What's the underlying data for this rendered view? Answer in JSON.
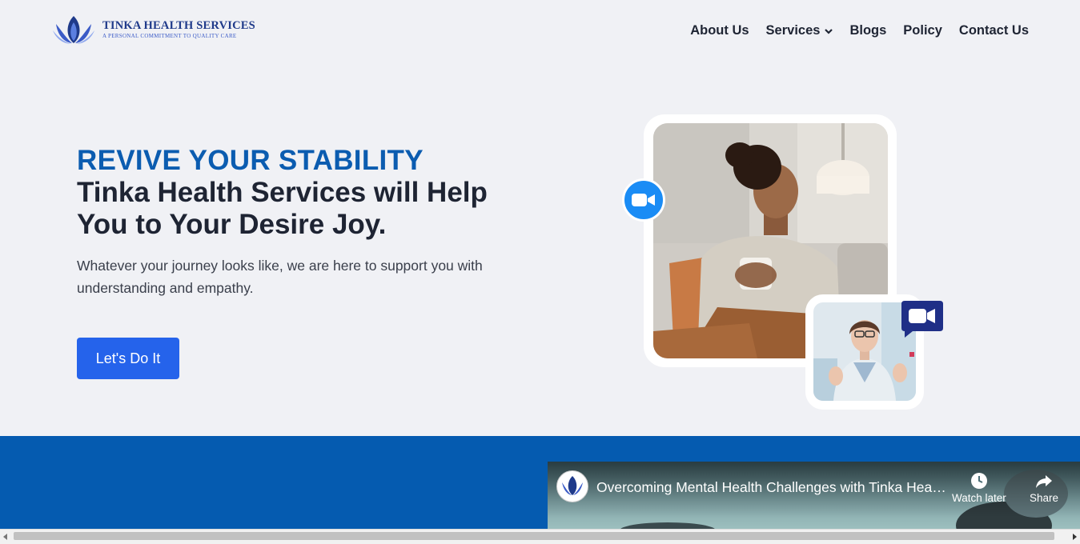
{
  "brand": {
    "name": "TINKA HEALTH SERVICES",
    "tagline": "A PERSONAL COMMITMENT TO QUALITY CARE",
    "logo_icon": "lotus-icon",
    "color": "#1f3a8a"
  },
  "nav": {
    "items": [
      {
        "label": "About Us"
      },
      {
        "label": "Services",
        "has_dropdown": true
      },
      {
        "label": "Blogs"
      },
      {
        "label": "Policy"
      },
      {
        "label": "Contact Us"
      }
    ]
  },
  "hero": {
    "eyebrow": "REVIVE YOUR STABILITY",
    "title": "Tinka Health Services will Help You to Your Desire Joy.",
    "text": "Whatever your journey looks like, we are here to support you with understanding and empathy.",
    "cta_label": "Let's Do It",
    "badges": [
      "video-call-icon",
      "video-chat-icon"
    ]
  },
  "video": {
    "title": "Overcoming Mental Health Challenges with Tinka Health Services",
    "watch_later_label": "Watch later",
    "share_label": "Share"
  },
  "colors": {
    "background": "#f0f1f5",
    "accent_blue": "#0b5cb0",
    "cta_blue": "#2563eb",
    "band_blue": "#055bb0",
    "text_dark": "#1e2433"
  }
}
